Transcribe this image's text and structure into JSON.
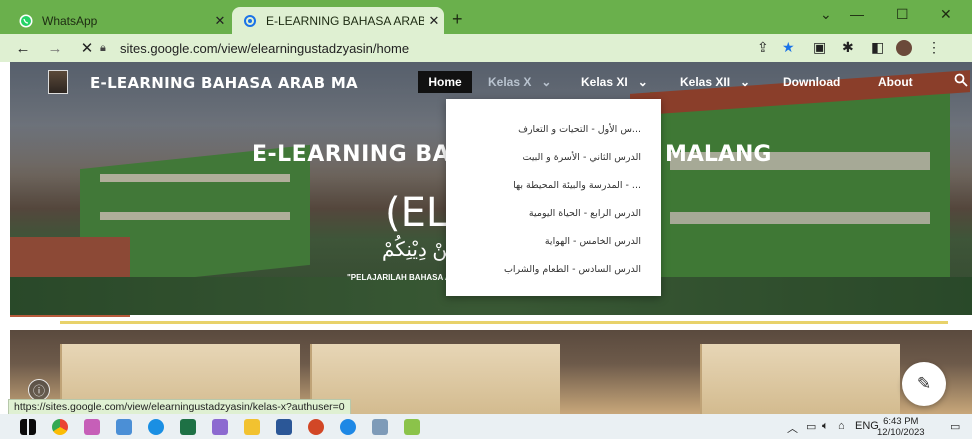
{
  "browser": {
    "tabs": [
      {
        "label": "WhatsApp",
        "icon": "whatsapp-icon",
        "active": false
      },
      {
        "label": "E-LEARNING BAHASA ARAB MA",
        "icon": "google-sites-icon",
        "active": true
      }
    ],
    "new_tab": "+",
    "url": "sites.google.com/view/elearningustadzyasin/home",
    "status_url": "https://sites.google.com/view/elearningustadzyasin/kelas-x?authuser=0"
  },
  "site": {
    "name": "E-LEARNING BAHASA ARAB MA",
    "nav": [
      {
        "label": "Home",
        "active": true
      },
      {
        "label": "Kelas X",
        "has_dropdown": true
      },
      {
        "label": "Kelas XI",
        "has_dropdown": true
      },
      {
        "label": "Kelas XII",
        "has_dropdown": true
      },
      {
        "label": "Download"
      },
      {
        "label": "About"
      }
    ],
    "dropdown_items": [
      "...س الأول - التحيات و التعارف",
      "الدرس الثاني - الأسرة و البيت",
      "... - المدرسة والبيئة المحيطة بها",
      "الدرس الرابع - الحياة اليومية",
      "الدرس الخامس - الهواية",
      "الدرس السادس - الطعام والشراب"
    ],
    "hero": {
      "title_left": "E-LEARNING BAHAS",
      "title_right": "MALANG",
      "subtitle": "(EL-B",
      "arabic": "زْءَةٌ مِنْ دِيْنِكُمْ",
      "slogan": "\"PELAJARILAH BAHASA ARAB"
    }
  },
  "taskbar": {
    "tray_lang": "ENG",
    "time": "6:43 PM",
    "date": "12/10/2023"
  },
  "colors": {
    "tab_strip": "#6ab04c",
    "toolbar": "#dff0d2",
    "nav_active_bg": "#111111"
  }
}
